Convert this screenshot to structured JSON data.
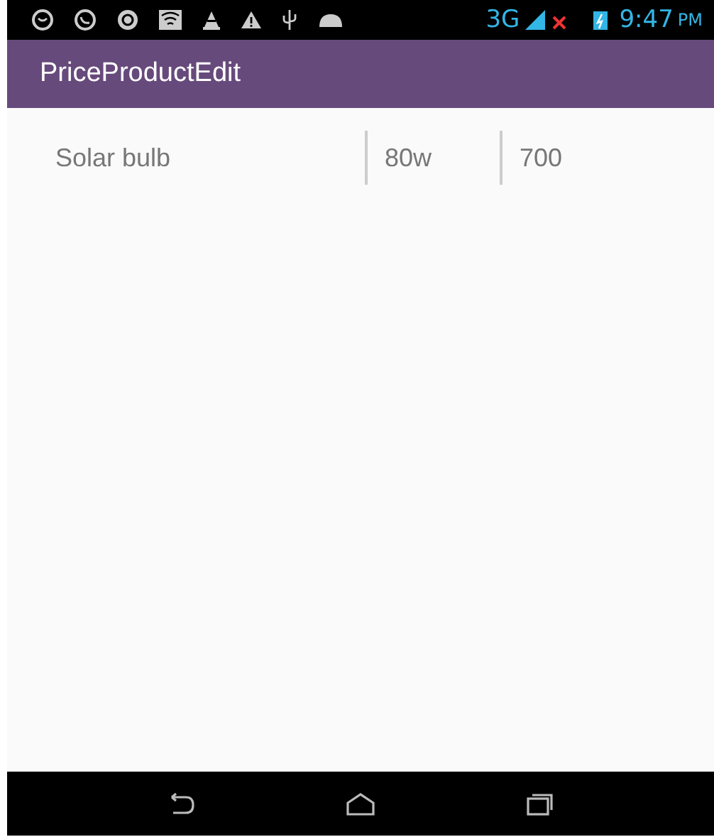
{
  "status_bar": {
    "network": "3G",
    "time": "9:47",
    "ampm": "PM"
  },
  "app_bar": {
    "title": "PriceProductEdit"
  },
  "rows": [
    {
      "name": "Solar bulb",
      "size": "80w",
      "price": "700"
    }
  ]
}
